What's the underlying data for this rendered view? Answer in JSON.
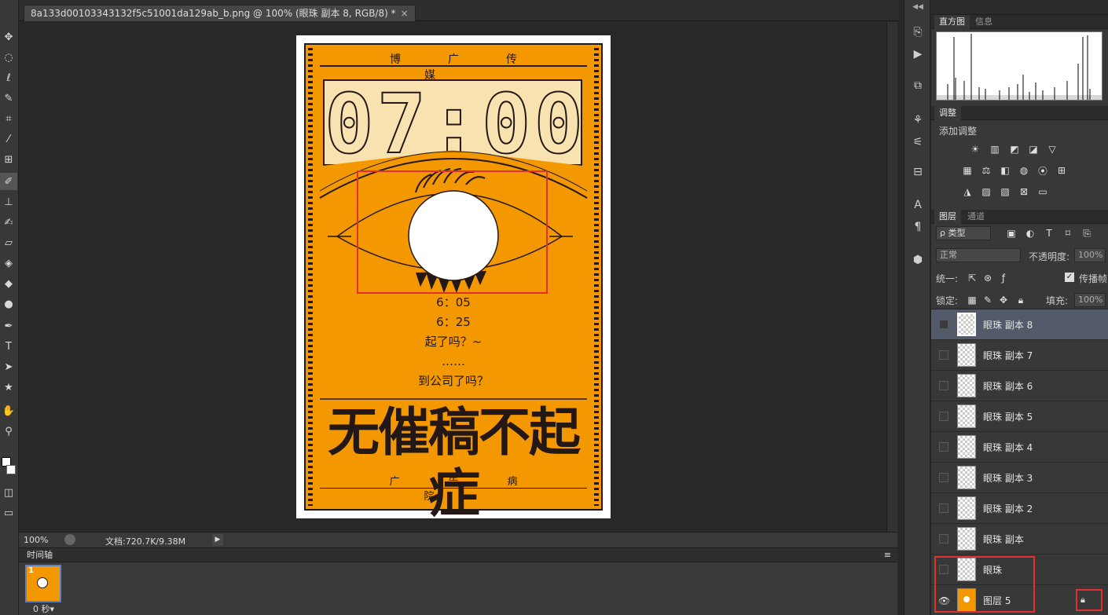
{
  "document": {
    "tab_title": "8a133d00103343132f5c51001da129ab_b.png @ 100% (眼珠 副本 8, RGB/8) *",
    "close_glyph": "×",
    "zoom": "100%",
    "doc_info": "文档:720.7K/9.38M"
  },
  "poster": {
    "header": "博广传媒",
    "clock": "07:00",
    "lines": [
      "6：05",
      "6：25",
      "起了吗？~",
      "……",
      "到公司了吗？"
    ],
    "headline": "无催稿不起症",
    "footer": "广告病院",
    "colors": {
      "orange": "#f39800",
      "cream": "#f8e3b0",
      "ink": "#231815"
    }
  },
  "timeline": {
    "title": "时间轴",
    "frame_number": "1",
    "frame_delay": "0 秒▾"
  },
  "panels": {
    "histogram_tabs": [
      "直方图",
      "信息"
    ],
    "adjustments_tab": "调整",
    "add_adjustment": "添加调整",
    "layers_tabs": [
      "图层",
      "通道"
    ],
    "filter_kind": "ρ 类型",
    "blend_mode": "正常",
    "opacity_label": "不透明度:",
    "opacity_value": "100%",
    "unify_label": "统一:",
    "propagate_label": "传播帧",
    "lock_label": "锁定:",
    "fill_label": "填充:",
    "fill_value": "100%"
  },
  "layers": [
    {
      "name": "眼珠 副本 8",
      "selected": true,
      "visible": false
    },
    {
      "name": "眼珠 副本 7",
      "selected": false,
      "visible": false
    },
    {
      "name": "眼珠 副本 6",
      "selected": false,
      "visible": false
    },
    {
      "name": "眼珠 副本 5",
      "selected": false,
      "visible": false
    },
    {
      "name": "眼珠 副本 4",
      "selected": false,
      "visible": false
    },
    {
      "name": "眼珠 副本 3",
      "selected": false,
      "visible": false
    },
    {
      "name": "眼珠 副本 2",
      "selected": false,
      "visible": false
    },
    {
      "name": "眼珠 副本",
      "selected": false,
      "visible": false
    },
    {
      "name": "眼珠",
      "selected": false,
      "visible": false
    },
    {
      "name": "图层 5",
      "selected": false,
      "visible": true
    }
  ]
}
